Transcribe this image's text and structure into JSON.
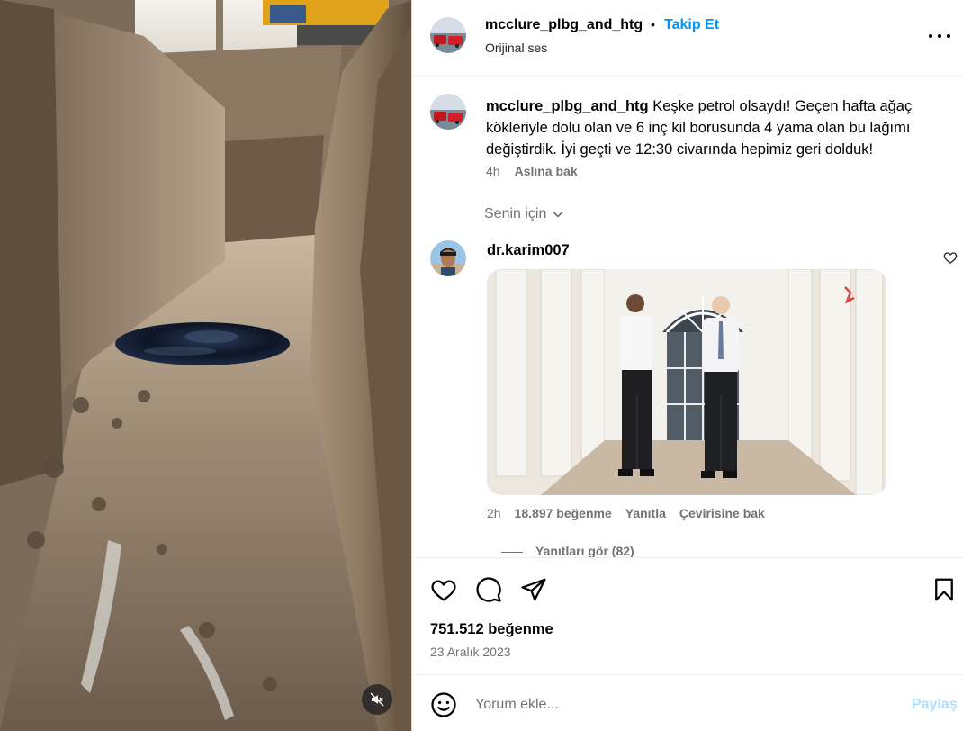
{
  "media": {
    "alt_icon": "speaker-muted-icon"
  },
  "header": {
    "username": "mcclure_plbg_and_htg",
    "separator": "•",
    "follow_label": "Takip Et",
    "audio_label": "Orijinal ses",
    "more_icon": "more-options-icon"
  },
  "caption": {
    "username": "mcclure_plbg_and_htg",
    "text": "Keşke petrol olsaydı! Geçen hafta ağaç kökleriyle dolu olan ve 6 inç kil borusunda 4 yama olan bu lağımı değiştirdik. İyi geçti ve 12:30 civarında hepimiz geri dolduk!",
    "time": "4h",
    "see_original": "Aslına bak"
  },
  "filter": {
    "label": "Senin için"
  },
  "comment": {
    "username": "dr.karim007",
    "time": "2h",
    "likes": "18.897 beğenme",
    "reply": "Yanıtla",
    "translate": "Çevirisine bak",
    "view_replies": "Yanıtları gör (82)"
  },
  "actions": {
    "like_icon": "heart-icon",
    "comment_icon": "comment-bubble-icon",
    "share_icon": "send-icon",
    "save_icon": "bookmark-icon",
    "likes_count": "751.512 beğenme",
    "date": "23 Aralık 2023"
  },
  "composer": {
    "placeholder": "Yorum ekle...",
    "post_label": "Paylaş"
  },
  "colors": {
    "accent": "#0095f6",
    "muted": "#737373",
    "post_disabled": "#b2dffc"
  }
}
